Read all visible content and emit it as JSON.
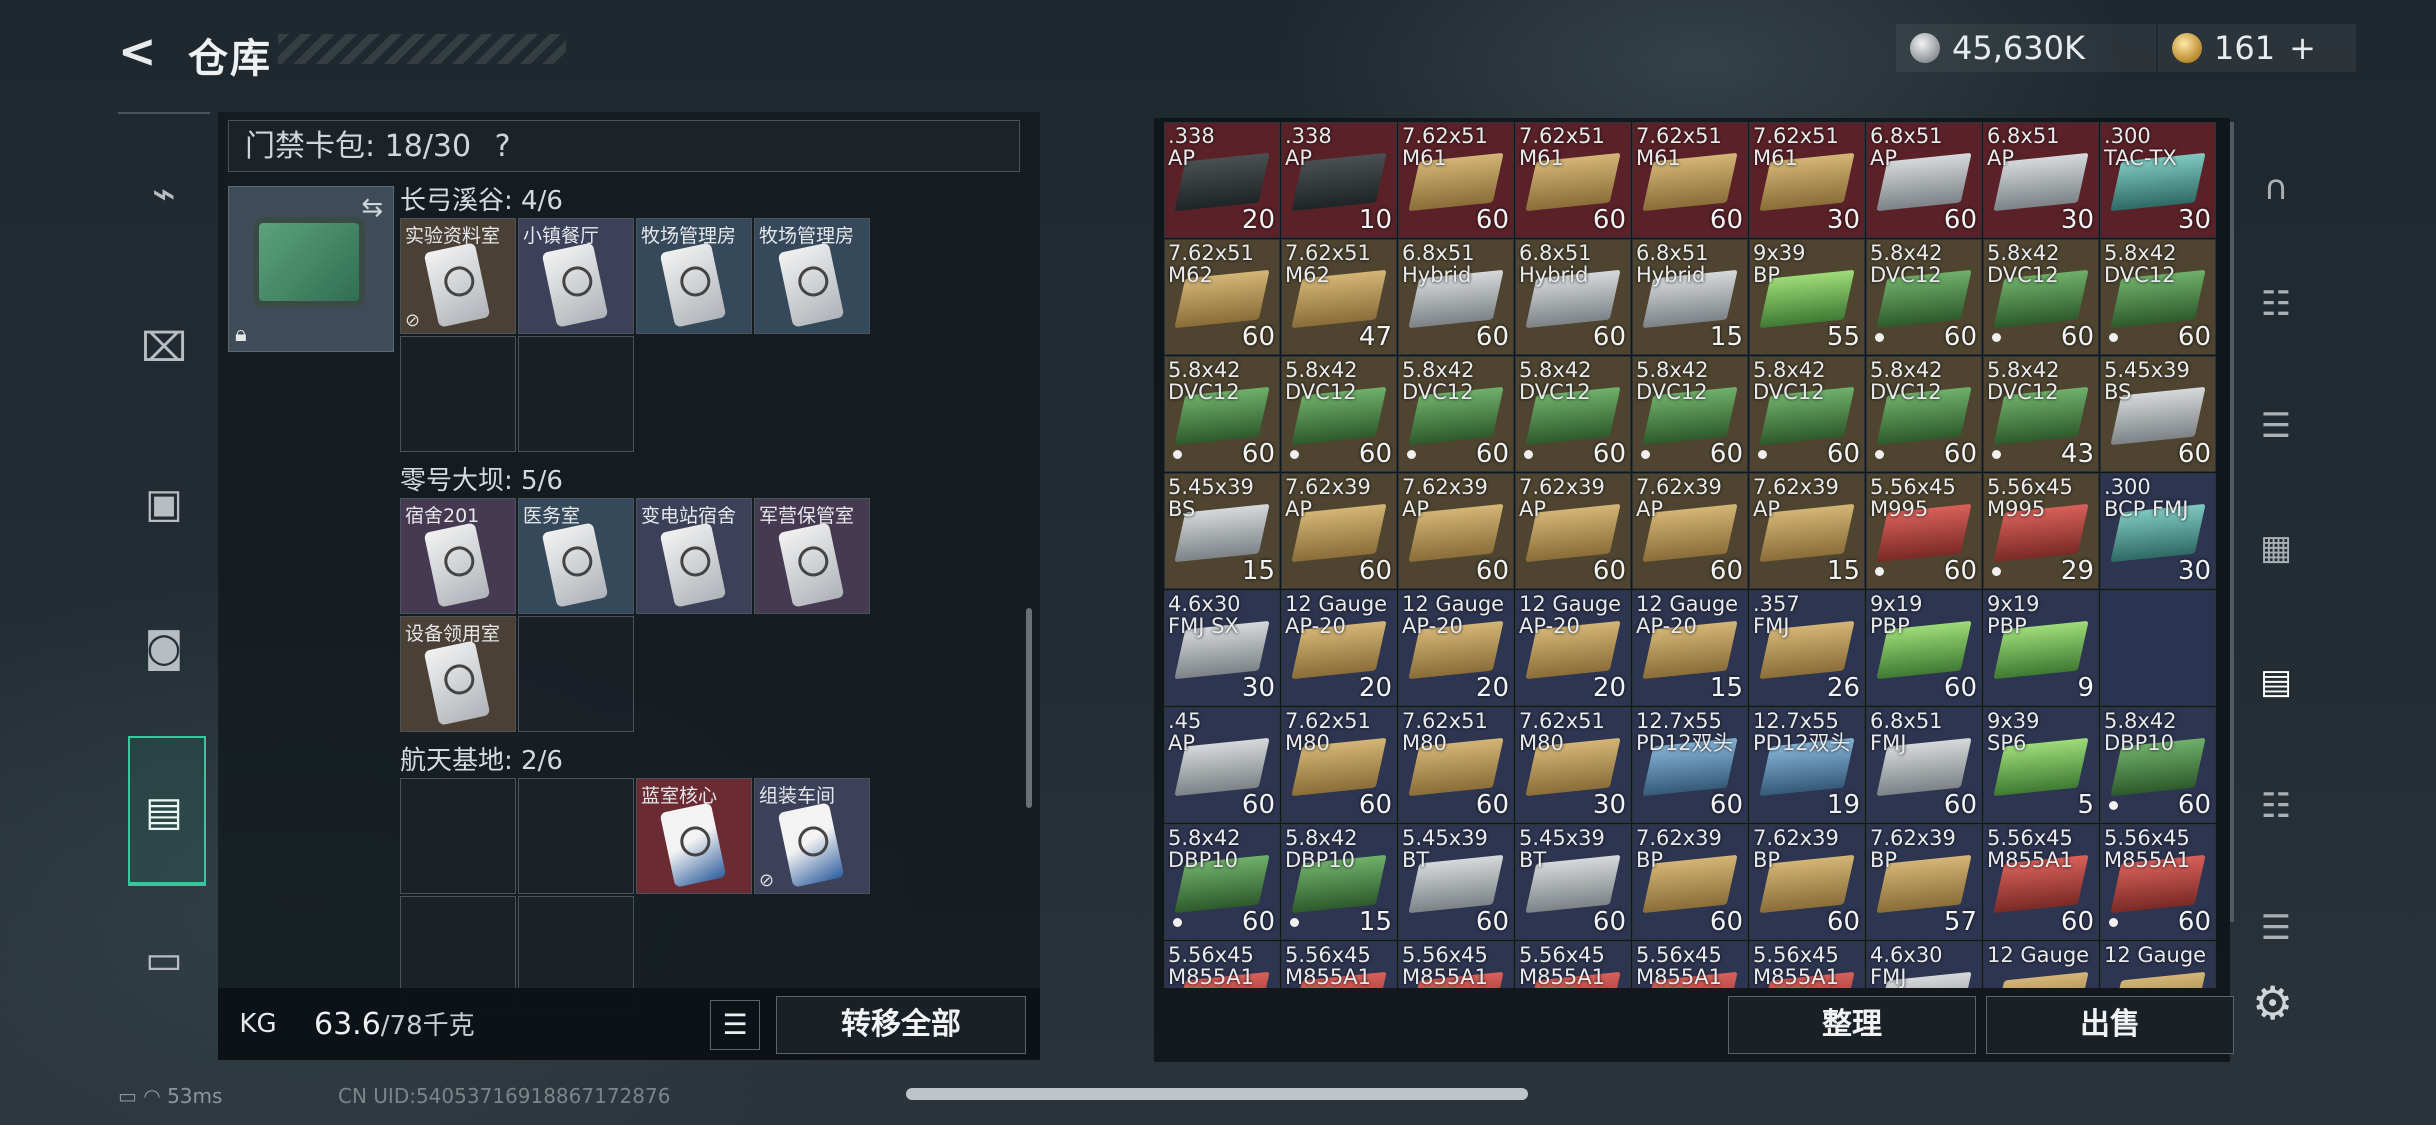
{
  "header": {
    "title": "仓库",
    "silver": "45,630K",
    "gold": "161",
    "gold_add": "+"
  },
  "left_nav": [
    "pistol-icon",
    "vest-icon",
    "armor-icon",
    "backpack-icon",
    "keycard-case-icon",
    "toolbox-icon"
  ],
  "keycard_bag": {
    "label": "门禁卡包: 18/30",
    "help": "?",
    "zones": [
      {
        "name": "长弓溪谷: 4/6",
        "cards": [
          "实验资料室",
          "小镇餐厅",
          "牧场管理房",
          "牧场管理房"
        ]
      },
      {
        "name": "零号大坝: 5/6",
        "cards": [
          "宿舍201",
          "医务室",
          "变电站宿舍",
          "军营保管室",
          "设备领用室"
        ]
      },
      {
        "name": "航天基地: 2/6",
        "cards": [
          "蓝室核心",
          "组装车间"
        ]
      }
    ]
  },
  "bottom": {
    "weight_current": "63.6",
    "weight_max": "/78千克",
    "kg_label": "KG",
    "transfer_all": "转移全部"
  },
  "actions": {
    "sort": "整理",
    "sell": "出售"
  },
  "status": {
    "ping": "53ms",
    "uid": "CN UID:54053716918867172876"
  },
  "items": [
    {
      "name": ".338\nAP",
      "count": "20",
      "bg": "red",
      "box": "dark"
    },
    {
      "name": ".338\nAP",
      "count": "10",
      "bg": "red",
      "box": "dark"
    },
    {
      "name": "7.62x51\nM61",
      "count": "60",
      "bg": "red",
      "box": "tan"
    },
    {
      "name": "7.62x51\nM61",
      "count": "60",
      "bg": "red",
      "box": "tan"
    },
    {
      "name": "7.62x51\nM61",
      "count": "60",
      "bg": "red",
      "box": "tan"
    },
    {
      "name": "7.62x51\nM61",
      "count": "30",
      "bg": "red",
      "box": "tan"
    },
    {
      "name": "6.8x51\nAP",
      "count": "60",
      "bg": "red",
      "box": "silver"
    },
    {
      "name": "6.8x51\nAP",
      "count": "30",
      "bg": "red",
      "box": "silver"
    },
    {
      "name": ".300\nTAC-TX",
      "count": "30",
      "bg": "red",
      "box": "teal"
    },
    {
      "name": "7.62x51\nM62",
      "count": "60",
      "bg": "gold",
      "box": "tan"
    },
    {
      "name": "7.62x51\nM62",
      "count": "47",
      "bg": "gold",
      "box": "tan"
    },
    {
      "name": "6.8x51\nHybrid",
      "count": "60",
      "bg": "gold",
      "box": "silver"
    },
    {
      "name": "6.8x51\nHybrid",
      "count": "60",
      "bg": "gold",
      "box": "silver"
    },
    {
      "name": "6.8x51\nHybrid",
      "count": "15",
      "bg": "gold",
      "box": "silver"
    },
    {
      "name": "9x39\nBP",
      "count": "55",
      "bg": "gold",
      "box": "lime"
    },
    {
      "name": "5.8x42\nDVC12",
      "count": "60",
      "bg": "gold",
      "box": "green",
      "dot": true
    },
    {
      "name": "5.8x42\nDVC12",
      "count": "60",
      "bg": "gold",
      "box": "green",
      "dot": true
    },
    {
      "name": "5.8x42\nDVC12",
      "count": "60",
      "bg": "gold",
      "box": "green",
      "dot": true
    },
    {
      "name": "5.8x42\nDVC12",
      "count": "60",
      "bg": "gold",
      "box": "green",
      "dot": true
    },
    {
      "name": "5.8x42\nDVC12",
      "count": "60",
      "bg": "gold",
      "box": "green",
      "dot": true
    },
    {
      "name": "5.8x42\nDVC12",
      "count": "60",
      "bg": "gold",
      "box": "green",
      "dot": true
    },
    {
      "name": "5.8x42\nDVC12",
      "count": "60",
      "bg": "gold",
      "box": "green",
      "dot": true
    },
    {
      "name": "5.8x42\nDVC12",
      "count": "60",
      "bg": "gold",
      "box": "green",
      "dot": true
    },
    {
      "name": "5.8x42\nDVC12",
      "count": "60",
      "bg": "gold",
      "box": "green",
      "dot": true
    },
    {
      "name": "5.8x42\nDVC12",
      "count": "60",
      "bg": "gold",
      "box": "green",
      "dot": true
    },
    {
      "name": "5.8x42\nDVC12",
      "count": "43",
      "bg": "gold",
      "box": "green",
      "dot": true
    },
    {
      "name": "5.45x39\nBS",
      "count": "60",
      "bg": "gold",
      "box": "silver"
    },
    {
      "name": "5.45x39\nBS",
      "count": "15",
      "bg": "gold",
      "box": "silver"
    },
    {
      "name": "7.62x39\nAP",
      "count": "60",
      "bg": "gold",
      "box": "tan"
    },
    {
      "name": "7.62x39\nAP",
      "count": "60",
      "bg": "gold",
      "box": "tan"
    },
    {
      "name": "7.62x39\nAP",
      "count": "60",
      "bg": "gold",
      "box": "tan"
    },
    {
      "name": "7.62x39\nAP",
      "count": "60",
      "bg": "gold",
      "box": "tan"
    },
    {
      "name": "7.62x39\nAP",
      "count": "15",
      "bg": "gold",
      "box": "tan"
    },
    {
      "name": "5.56x45\nM995",
      "count": "60",
      "bg": "gold",
      "box": "redbox",
      "dot": true
    },
    {
      "name": "5.56x45\nM995",
      "count": "29",
      "bg": "gold",
      "box": "redbox",
      "dot": true
    },
    {
      "name": ".300\nBCP FMJ",
      "count": "30",
      "bg": "blue",
      "box": "teal"
    },
    {
      "name": "4.6x30\nFMJ SX",
      "count": "30",
      "bg": "blue",
      "box": "silver"
    },
    {
      "name": "12 Gauge\nAP-20",
      "count": "20",
      "bg": "blue",
      "box": "tan"
    },
    {
      "name": "12 Gauge\nAP-20",
      "count": "20",
      "bg": "blue",
      "box": "tan"
    },
    {
      "name": "12 Gauge\nAP-20",
      "count": "20",
      "bg": "blue",
      "box": "tan"
    },
    {
      "name": "12 Gauge\nAP-20",
      "count": "15",
      "bg": "blue",
      "box": "tan"
    },
    {
      "name": ".357\nFMJ",
      "count": "26",
      "bg": "blue",
      "box": "tan"
    },
    {
      "name": "9x19\nPBP",
      "count": "60",
      "bg": "blue",
      "box": "lime"
    },
    {
      "name": "9x19\nPBP",
      "count": "9",
      "bg": "blue",
      "box": "lime"
    },
    null,
    {
      "name": ".45\nAP",
      "count": "60",
      "bg": "blue",
      "box": "silver"
    },
    {
      "name": "7.62x51\nM80",
      "count": "60",
      "bg": "blue",
      "box": "tan"
    },
    {
      "name": "7.62x51\nM80",
      "count": "60",
      "bg": "blue",
      "box": "tan"
    },
    {
      "name": "7.62x51\nM80",
      "count": "30",
      "bg": "blue",
      "box": "tan"
    },
    {
      "name": "12.7x55\nPD12双头",
      "count": "60",
      "bg": "blue",
      "box": "blue"
    },
    {
      "name": "12.7x55\nPD12双头",
      "count": "19",
      "bg": "blue",
      "box": "blue"
    },
    {
      "name": "6.8x51\nFMJ",
      "count": "60",
      "bg": "blue",
      "box": "silver"
    },
    {
      "name": "9x39\nSP6",
      "count": "5",
      "bg": "blue",
      "box": "lime"
    },
    {
      "name": "5.8x42\nDBP10",
      "count": "60",
      "bg": "blue",
      "box": "green",
      "dot": true
    },
    {
      "name": "5.8x42\nDBP10",
      "count": "60",
      "bg": "blue",
      "box": "green",
      "dot": true
    },
    {
      "name": "5.8x42\nDBP10",
      "count": "15",
      "bg": "blue",
      "box": "green",
      "dot": true
    },
    {
      "name": "5.45x39\nBT",
      "count": "60",
      "bg": "blue",
      "box": "silver"
    },
    {
      "name": "5.45x39\nBT",
      "count": "60",
      "bg": "blue",
      "box": "silver"
    },
    {
      "name": "7.62x39\nBP",
      "count": "60",
      "bg": "blue",
      "box": "tan"
    },
    {
      "name": "7.62x39\nBP",
      "count": "60",
      "bg": "blue",
      "box": "tan"
    },
    {
      "name": "7.62x39\nBP",
      "count": "57",
      "bg": "blue",
      "box": "tan"
    },
    {
      "name": "5.56x45\nM855A1",
      "count": "60",
      "bg": "blue",
      "box": "redbox"
    },
    {
      "name": "5.56x45\nM855A1",
      "count": "60",
      "bg": "blue",
      "box": "redbox",
      "dot": true
    },
    {
      "name": "5.56x45\nM855A1",
      "count": "",
      "bg": "blue",
      "box": "redbox"
    },
    {
      "name": "5.56x45\nM855A1",
      "count": "",
      "bg": "blue",
      "box": "redbox"
    },
    {
      "name": "5.56x45\nM855A1",
      "count": "",
      "bg": "blue",
      "box": "redbox"
    },
    {
      "name": "5.56x45\nM855A1",
      "count": "",
      "bg": "blue",
      "box": "redbox"
    },
    {
      "name": "5.56x45\nM855A1",
      "count": "",
      "bg": "blue",
      "box": "redbox"
    },
    {
      "name": "5.56x45\nM855A1",
      "count": "",
      "bg": "blue",
      "box": "redbox"
    },
    {
      "name": "4.6x30\nFMJ",
      "count": "",
      "bg": "blue",
      "box": "silver"
    },
    {
      "name": "12 Gauge\n",
      "count": "",
      "bg": "blue",
      "box": "tan"
    },
    {
      "name": "12 Gauge\n",
      "count": "",
      "bg": "blue",
      "box": "tan"
    }
  ],
  "right_nav": [
    "helmet-icon",
    "tier3-armor-icon",
    "tier3-rig-icon",
    "tier5-item-icon",
    "tier4-case-icon",
    "tier3-tool-icon",
    "tier3-bag-icon"
  ]
}
